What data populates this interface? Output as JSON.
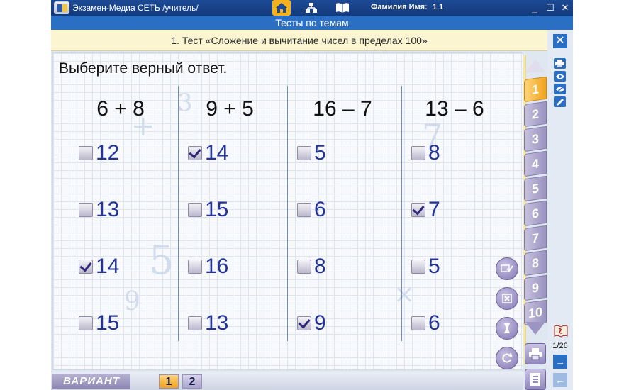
{
  "titlebar": {
    "app_title": "Экзамен-Медиа СЕТЬ /учитель/",
    "user_label": "Фамилия Имя:",
    "user_value": "1 1",
    "nav": [
      "home-icon",
      "tree-icon",
      "book-icon"
    ],
    "window_buttons": [
      "_",
      "☐",
      "✕"
    ]
  },
  "section_title": "Тесты по темам",
  "test_title": "1. Тест «Сложение и вычитание чисел в пределах 100»",
  "instruction": "Выберите верный ответ.",
  "problems": [
    {
      "expression": "6 + 8",
      "options": [
        {
          "value": "12",
          "checked": false
        },
        {
          "value": "13",
          "checked": false
        },
        {
          "value": "14",
          "checked": true
        },
        {
          "value": "15",
          "checked": false
        }
      ]
    },
    {
      "expression": "9 + 5",
      "options": [
        {
          "value": "14",
          "checked": true
        },
        {
          "value": "15",
          "checked": false
        },
        {
          "value": "16",
          "checked": false
        },
        {
          "value": "13",
          "checked": false
        }
      ]
    },
    {
      "expression": "16 – 7",
      "options": [
        {
          "value": "5",
          "checked": false
        },
        {
          "value": "6",
          "checked": false
        },
        {
          "value": "8",
          "checked": false
        },
        {
          "value": "9",
          "checked": true
        }
      ]
    },
    {
      "expression": "13 – 6",
      "options": [
        {
          "value": "8",
          "checked": false
        },
        {
          "value": "7",
          "checked": true
        },
        {
          "value": "5",
          "checked": false
        },
        {
          "value": "6",
          "checked": false
        }
      ]
    }
  ],
  "task_tabs": [
    "1",
    "2",
    "3",
    "4",
    "5",
    "6",
    "7",
    "8",
    "9",
    "10"
  ],
  "active_task": "1",
  "close_label": "✕",
  "page_counter": "1/26",
  "variant_label": "ВАРИАНТ",
  "variants": [
    "1",
    "2"
  ],
  "active_variant": "1",
  "colors": {
    "title_bar": "#1d4a95",
    "section_bar": "#2b6fc4",
    "accent_orange": "#f0a21c",
    "answer_blue": "#23339a",
    "tab_purple": "#9a92c0"
  }
}
